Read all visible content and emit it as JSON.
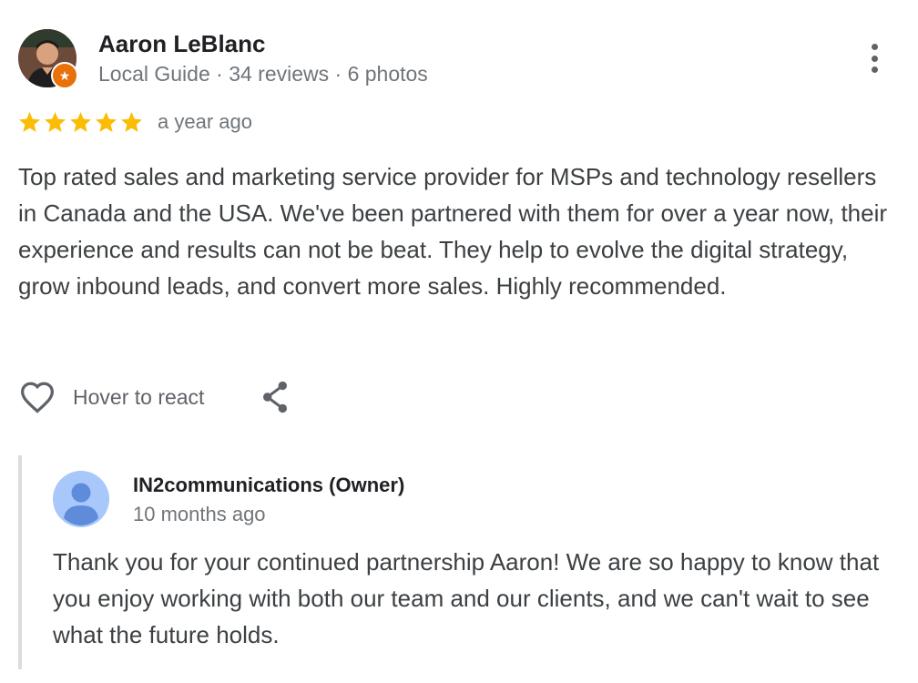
{
  "review": {
    "author": {
      "name": "Aaron LeBlanc",
      "meta": "Local Guide · 34 reviews · 6 photos",
      "badge_icon": "local-guide-star-icon",
      "badge_color": "#e8710a"
    },
    "rating": 5,
    "star_color": "#fbbc04",
    "date": "a year ago",
    "text": "Top rated sales and marketing service provider for MSPs and technology resellers in Canada and the USA. We've been partnered with them for over a year now, their experience and results can not be beat. They help to evolve the digital strategy, grow inbound leads, and convert more sales. Highly recommended.",
    "actions": {
      "react_label": "Hover to react",
      "react_icon": "heart-outline-icon",
      "share_icon": "share-icon",
      "more_icon": "more-vertical-icon"
    }
  },
  "owner_reply": {
    "name": "IN2communications (Owner)",
    "date": "10 months ago",
    "text": "Thank you for your continued partnership Aaron! We are so happy to know that you enjoy working with both our team and our clients, and we can't wait to see what the future holds.",
    "avatar_icon": "default-person-icon",
    "avatar_colors": {
      "background": "#a8c7fa",
      "figure": "#5e8cdb"
    }
  }
}
